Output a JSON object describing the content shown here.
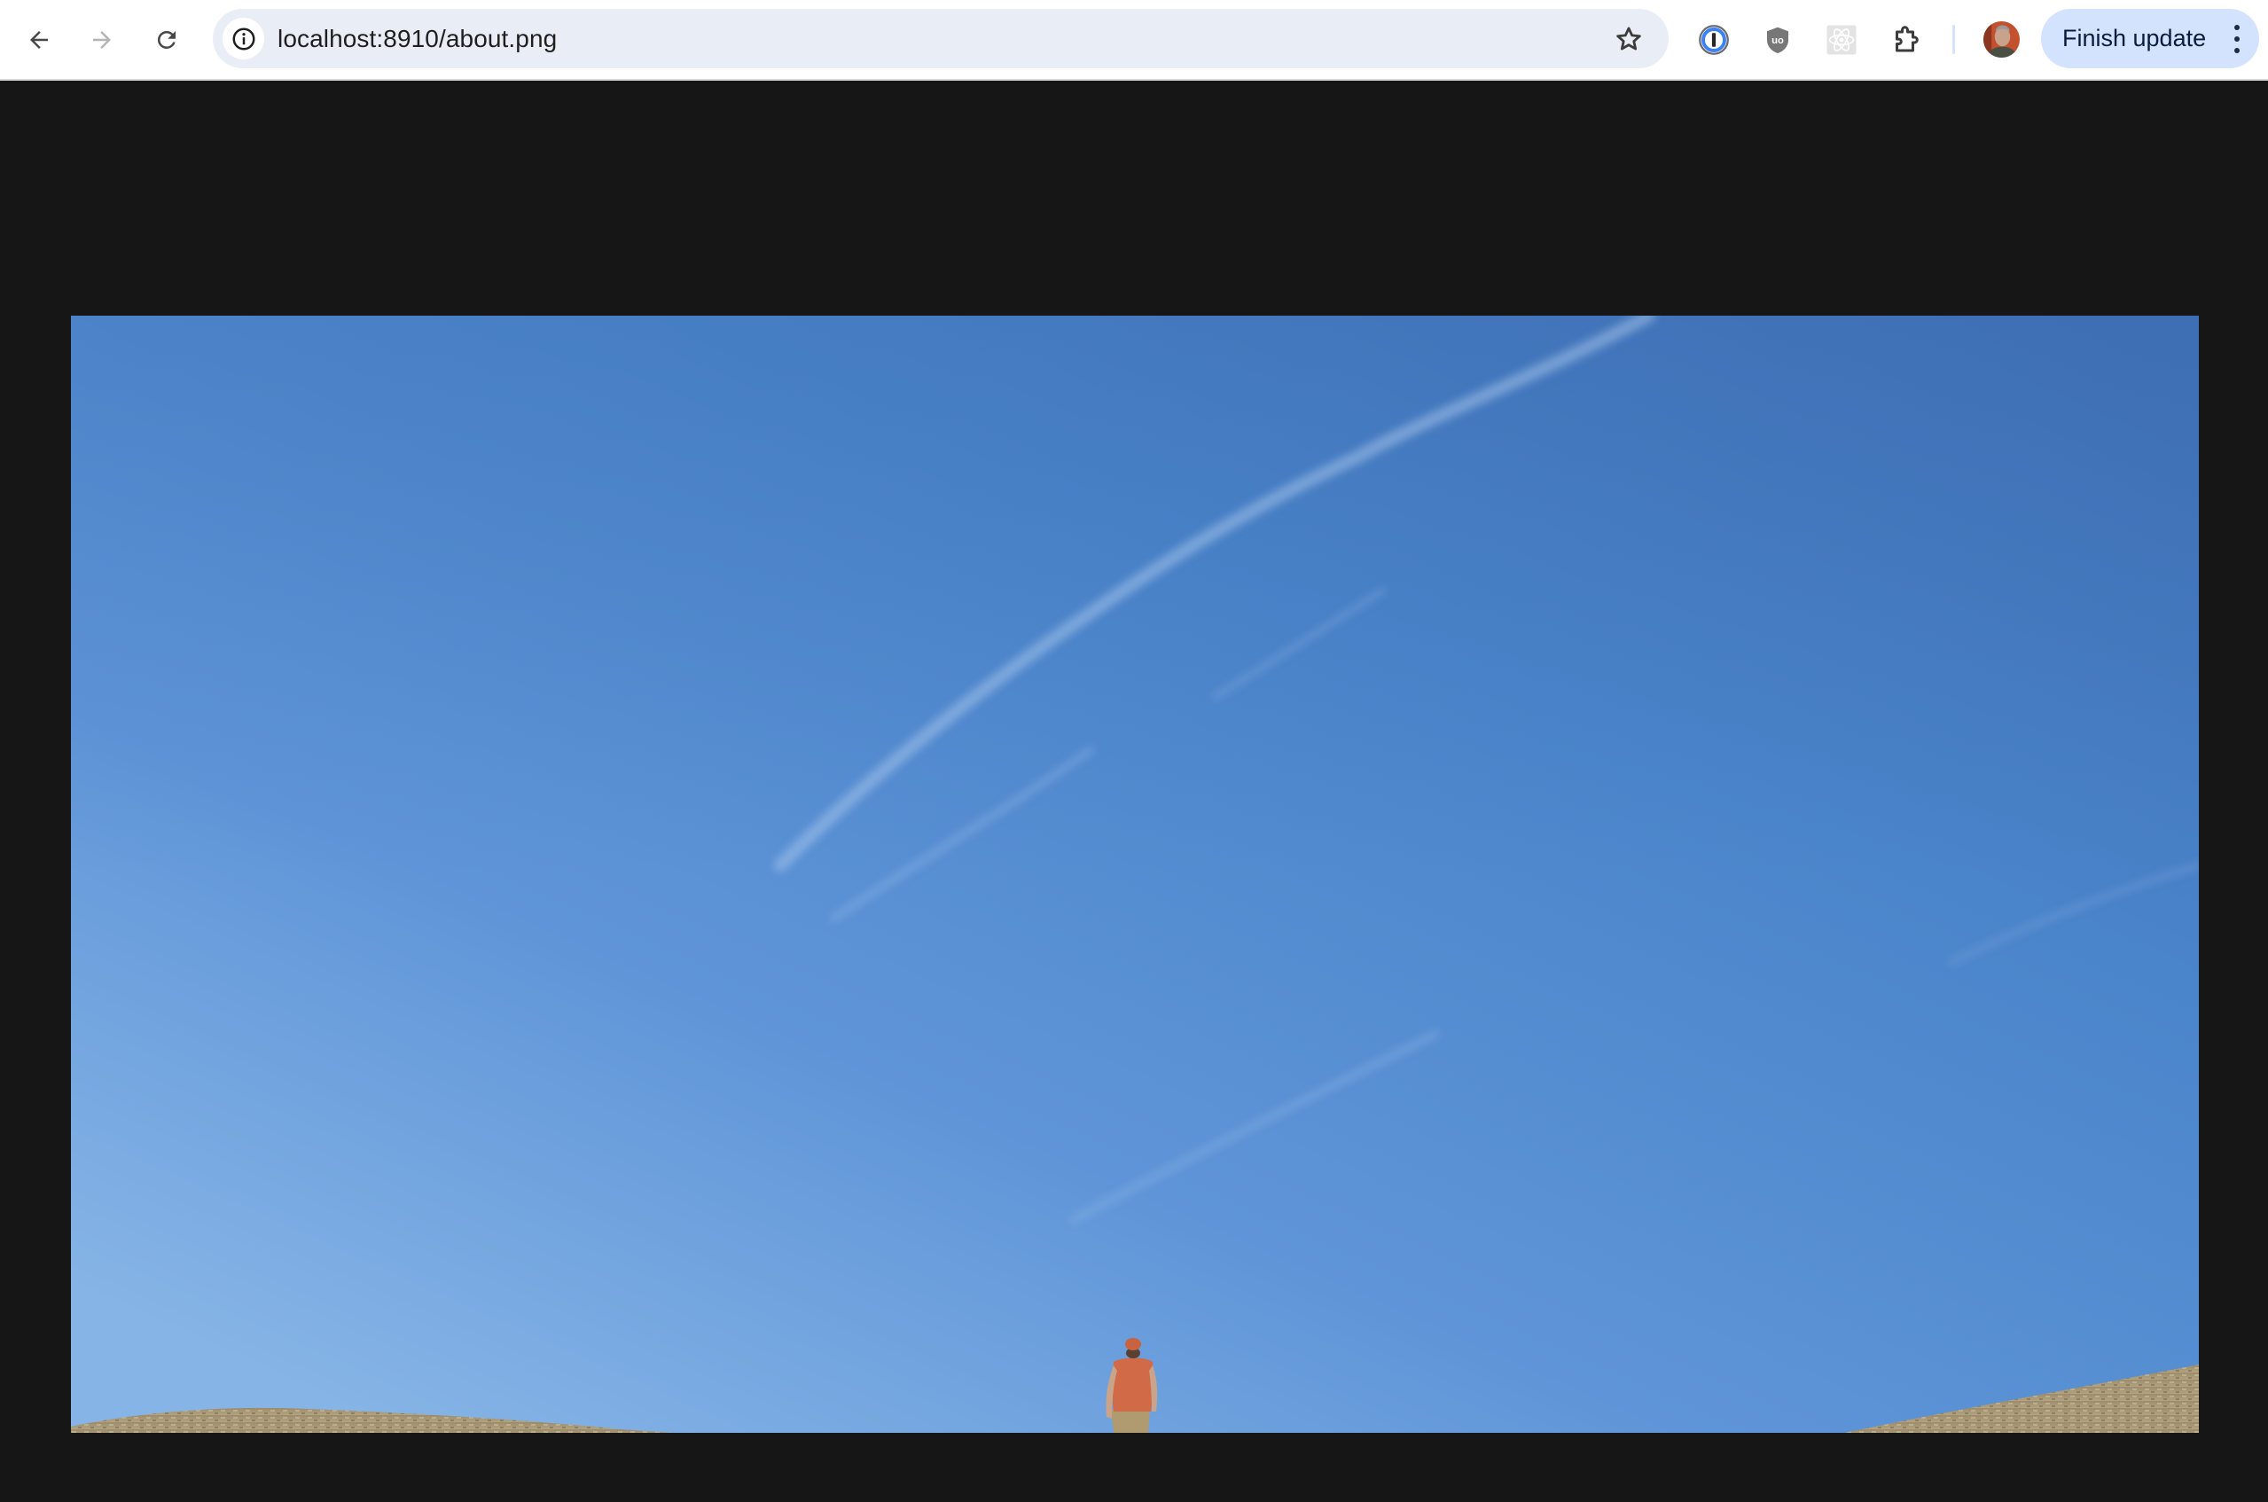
{
  "browser": {
    "url": "localhost:8910/about.png",
    "update_button_label": "Finish update",
    "nav": {
      "back_icon": "arrow-left-icon",
      "forward_icon": "arrow-right-icon",
      "reload_icon": "reload-icon",
      "forward_enabled": false
    },
    "omnibox": {
      "site_info_icon": "info-circle-icon",
      "bookmark_icon": "star-outline-icon"
    },
    "extensions": [
      {
        "name": "1Password",
        "icon": "onepassword-icon"
      },
      {
        "name": "uBlock Origin",
        "icon": "ublock-shield-icon"
      },
      {
        "name": "React Developer Tools",
        "icon": "react-atom-icon",
        "disabled": true
      },
      {
        "name": "Extensions",
        "icon": "puzzle-piece-icon"
      }
    ],
    "profile_icon": "avatar",
    "menu_icon": "kebab-menu-icon",
    "colors": {
      "omnibox_bg": "#e9edf5",
      "update_pill_bg": "#d3e3fd",
      "viewer_bg": "#161616"
    }
  },
  "content": {
    "image": {
      "description": "Photo of a person in a red-orange shirt and cap standing with back turned on a dry hilltop under a vast clear blue sky with faint contrails",
      "sky_colors": [
        "#3f72b8",
        "#4d86cc",
        "#7aace0"
      ],
      "ground_color": "#a89878",
      "shirt_color": "#d46a48"
    }
  }
}
